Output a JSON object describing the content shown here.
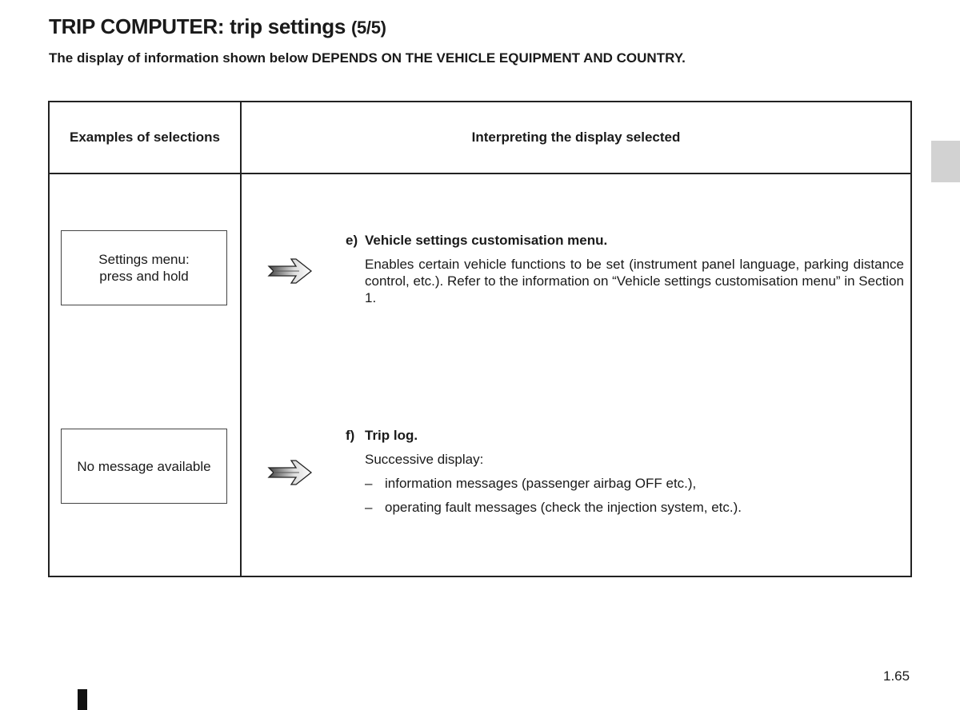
{
  "header": {
    "title": "TRIP COMPUTER: trip settings ",
    "part": "(5/5)",
    "subtitle": "The display of information shown below DEPENDS ON THE VEHICLE EQUIPMENT AND COUNTRY."
  },
  "table": {
    "col_headers": [
      "Examples of selections",
      "Interpreting the display selected"
    ],
    "rows": [
      {
        "selection_lines": [
          "Settings menu:",
          "press and hold"
        ],
        "arrow_icon": "double-arrow-right-icon",
        "label": "e)",
        "heading": "Vehicle settings customisation menu.",
        "description": "Enables certain vehicle functions to be set (instrument panel language, parking distance control, etc.). Refer to the information on “Vehicle settings customisation menu” in Section 1."
      },
      {
        "selection_lines": [
          "No message available"
        ],
        "arrow_icon": "double-arrow-right-icon",
        "label": "f)",
        "heading": "Trip log.",
        "description": "Successive display:",
        "bullets": [
          "information messages (passenger airbag OFF etc.),",
          "operating fault messages (check the injection system, etc.)."
        ],
        "bullet_glyph": "–"
      }
    ]
  },
  "footer": {
    "page_number": "1.65"
  },
  "colors": {
    "text": "#1a1a1a",
    "border": "#222222",
    "tab_marker": "#d2d2d2"
  }
}
